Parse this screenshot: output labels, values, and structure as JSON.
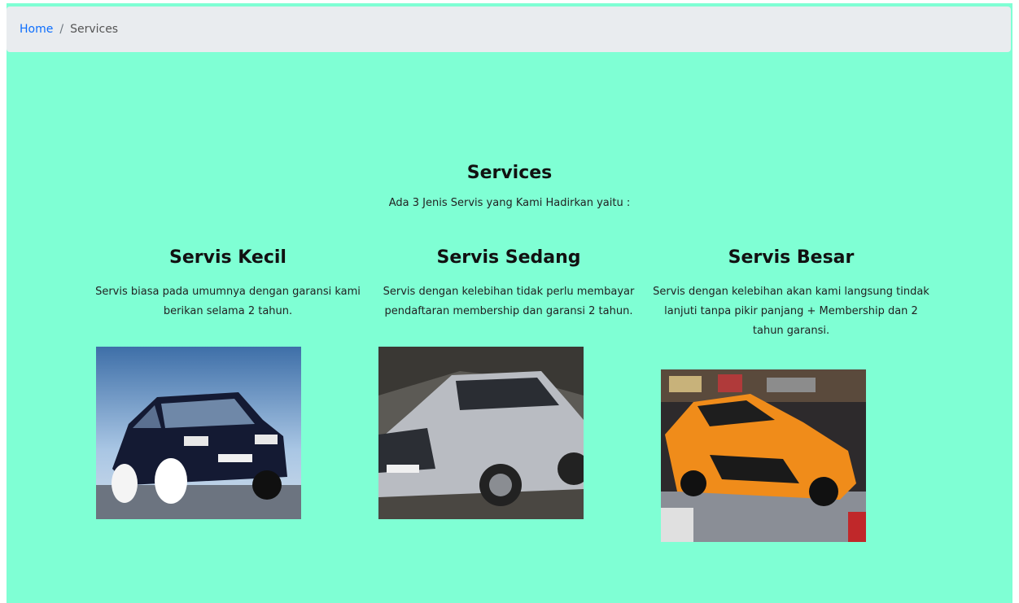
{
  "breadcrumb": {
    "home": "Home",
    "separator": "/",
    "current": "Services"
  },
  "main": {
    "title": "Services",
    "intro": "Ada 3 Jenis Servis yang Kami Hadirkan yaitu :"
  },
  "services": [
    {
      "title": "Servis Kecil",
      "description": "Servis biasa pada umumnya dengan garansi kami berikan selama 2 tahun.",
      "image": "hatchback-car-photo"
    },
    {
      "title": "Servis Sedang",
      "description": "Servis dengan kelebihan tidak perlu membayar pendaftaran membership dan garansi 2 tahun.",
      "image": "suv-car-photo"
    },
    {
      "title": "Servis Besar",
      "description": "Servis dengan kelebihan akan kami langsung tindak lanjuti tanpa pikir panjang + Membership dan 2 tahun garansi.",
      "image": "orange-sports-car-photo"
    }
  ],
  "colors": {
    "page_background": "#7fffd4",
    "breadcrumb_background": "#e9ecef",
    "link": "#0d6efd"
  }
}
